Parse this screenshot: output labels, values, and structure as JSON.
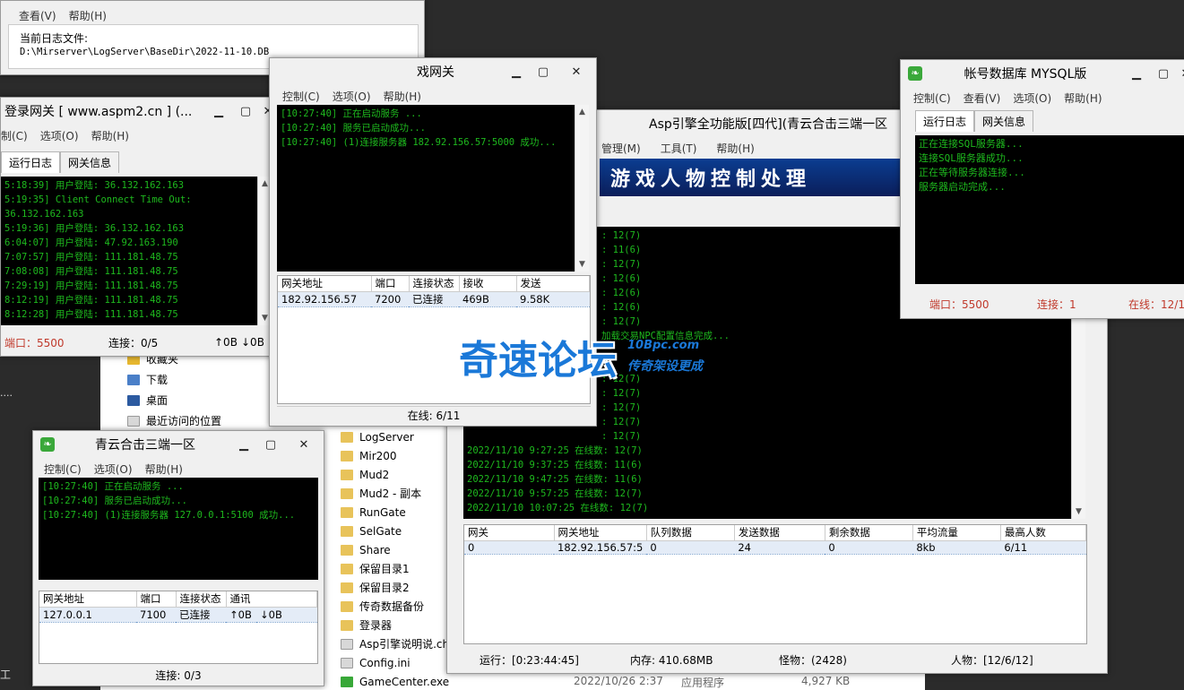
{
  "desktop_left": {
    "line1": "....",
    "line2": "工"
  },
  "logserver": {
    "menu": [
      "查看(V)",
      "帮助(H)"
    ],
    "label": "当前日志文件:",
    "path": "D:\\Mirserver\\LogServer\\BaseDir\\2022-11-10.DB"
  },
  "logingate": {
    "title": "登录网关 [ www.aspm2.cn ] (...",
    "menu": [
      "制(C)",
      "选项(O)",
      "帮助(H)"
    ],
    "tabs": [
      "运行日志",
      "网关信息"
    ],
    "log": [
      "5:18:39] 用户登陆: 36.132.162.163",
      "5:19:35] Client Connect Time Out:",
      "36.132.162.163",
      "5:19:36] 用户登陆: 36.132.162.163",
      "6:04:07] 用户登陆: 47.92.163.190",
      "7:07:57] 用户登陆: 111.181.48.75",
      "7:08:08] 用户登陆: 111.181.48.75",
      "7:29:19] 用户登陆: 111.181.48.75",
      "8:12:19] 用户登陆: 111.181.48.75",
      "8:12:28] 用户登陆: 111.181.48.75"
    ],
    "status_port": "端口：5500",
    "status_conn": "连接：0/5",
    "status_in": "↑0B",
    "status_out": "↓0B"
  },
  "selgate": {
    "title": "戏网关",
    "menu": [
      "控制(C)",
      "选项(O)",
      "帮助(H)"
    ],
    "log": [
      "[10:27:40] 正在启动服务 ...",
      "[10:27:40] 服务已启动成功...",
      "[10:27:40] (1)连接服务器 182.92.156.57:5000 成功..."
    ],
    "cols": [
      "网关地址",
      "端口",
      "连接状态",
      "接收",
      "发送"
    ],
    "row": [
      "182.92.156.57",
      "7200",
      "已连接",
      "469B",
      "9.58K"
    ],
    "status": "在线: 6/11"
  },
  "explorer": {
    "top": [
      {
        "name": "收藏夹",
        "icon": "star-icon"
      },
      {
        "name": "下载",
        "icon": "download-folder-icon"
      },
      {
        "name": "桌面",
        "icon": "desktop-icon"
      },
      {
        "name": "最近访问的位置",
        "icon": "recent-places-icon"
      }
    ],
    "files": [
      "LogServer",
      "Mir200",
      "Mud2",
      "Mud2 - 副本",
      "RunGate",
      "SelGate",
      "Share",
      "保留目录1",
      "保留目录2",
      "传奇数据备份",
      "登录器",
      "Asp引擎说明说.ch",
      "Config.ini",
      "GameCenter.exe"
    ],
    "last_date": "2022/10/26 2:37",
    "last_type": "应用程序",
    "last_size": "4,927 KB"
  },
  "engine": {
    "title": "Asp引擎全功能版[四代](青云合击三端一区",
    "menu": [
      "管理(M)",
      "工具(T)",
      "帮助(H)"
    ],
    "banner": "游戏人物控制处理",
    "log": [
      ": 12(7)",
      ": 11(6)",
      ": 12(7)",
      ": 12(6)",
      ": 12(6)",
      ": 12(6)",
      ": 12(7)",
      "加载交易NPC配置信息完成...",
      "",
      "",
      ": 12(7)",
      ": 12(7)",
      ": 12(7)",
      ": 12(7)",
      ": 12(7)",
      "2022/11/10 9:27:25 在线数: 12(7)",
      "2022/11/10 9:37:25 在线数: 11(6)",
      "2022/11/10 9:47:25 在线数: 11(6)",
      "2022/11/10 9:57:25 在线数: 12(7)",
      "2022/11/10 10:07:25 在线数: 12(7)"
    ],
    "cols": [
      "网关",
      "网关地址",
      "队列数据",
      "发送数据",
      "剩余数据",
      "平均流量",
      "最高人数"
    ],
    "row": [
      "0",
      "182.92.156.57:5",
      "0",
      "24",
      "0",
      "8kb",
      "6/11"
    ],
    "status_run": "运行：[0:23:44:45]",
    "status_mem": "内存: 410.68MB",
    "status_mon": "怪物：(2428)",
    "status_hum": "人物：[12/6/12]"
  },
  "rungate": {
    "title": "青云合击三端一区",
    "menu": [
      "控制(C)",
      "选项(O)",
      "帮助(H)"
    ],
    "log": [
      "[10:27:40] 正在启动服务 ...",
      "[10:27:40] 服务已启动成功...",
      "[10:27:40] (1)连接服务器 127.0.0.1:5100 成功..."
    ],
    "cols": [
      "网关地址",
      "端口",
      "连接状态",
      "通讯"
    ],
    "row": [
      "127.0.0.1",
      "7100",
      "已连接",
      "↑0B",
      "↓0B"
    ],
    "status": "连接: 0/3"
  },
  "dbserver": {
    "title": "帐号数据库 MYSQL版",
    "menu": [
      "控制(C)",
      "查看(V)",
      "选项(O)",
      "帮助(H)"
    ],
    "tabs": [
      "运行日志",
      "网关信息"
    ],
    "log": [
      "正在连接SQL服务器...",
      "连接SQL服务器成功...",
      "正在等待服务器连接...",
      "服务器启动完成..."
    ],
    "status_port": "端口：5500",
    "status_conn": "连接：1",
    "status_online": "在线：12/1"
  },
  "watermark": {
    "main": "奇速论坛",
    "sub1": "10Bpc.com",
    "sub2": "传奇架设更成"
  }
}
